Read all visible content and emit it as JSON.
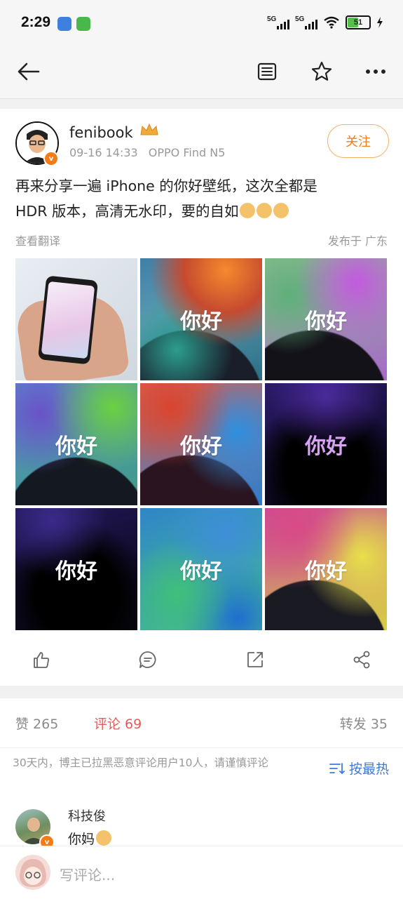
{
  "status_bar": {
    "time": "2:29",
    "signal1": "5G",
    "signal2": "5G",
    "battery": "51"
  },
  "nav": {
    "back_icon": "arrow-left-icon",
    "actions": [
      "document-icon",
      "star-icon",
      "more-icon"
    ]
  },
  "post": {
    "username": "fenibook",
    "timestamp": "09-16 14:33",
    "device": "OPPO Find N5",
    "follow_label": "关注",
    "text_line1": "再来分享一遍 iPhone 的你好壁纸，这次全都是",
    "text_line2": "HDR 版本，高清无水印，要的自如",
    "translate_label": "查看翻译",
    "location_label": "发布于 广东",
    "tile_text": "你好",
    "actions": [
      "like-icon",
      "comment-icon",
      "share-out-icon",
      "share-icon"
    ]
  },
  "stats": {
    "likes": "赞 265",
    "comments": "评论 69",
    "reposts": "转发 35",
    "notice": "30天内，博主已拉黑恶意评论用户10人，请谨慎评论",
    "sort_label": "按最热"
  },
  "comment": {
    "name": "科技俊",
    "text": "你妈"
  },
  "composer": {
    "placeholder": "写评论..."
  },
  "colors": {
    "accent_orange": "#f07c1f",
    "active_red": "#e85a5a",
    "link_blue": "#3d7bd6"
  }
}
